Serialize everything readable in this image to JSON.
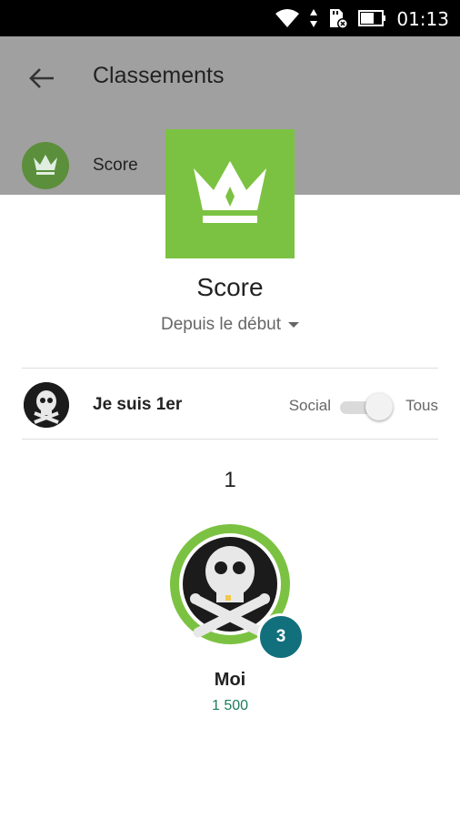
{
  "status_bar": {
    "time": "01:13",
    "icons": [
      "wifi-icon",
      "data-arrows-icon",
      "sd-card-icon",
      "battery-icon"
    ]
  },
  "app_bar": {
    "title": "Classements",
    "back_icon": "arrow-left-icon"
  },
  "leaderboard_item": {
    "label": "Score",
    "icon": "crown-icon",
    "color": "#5c8f3b"
  },
  "leaderboard": {
    "tile_color": "#7cc242",
    "title": "Score",
    "period": "Depuis le début",
    "player_title": "Je suis 1er",
    "toggle_left": "Social",
    "toggle_right": "Tous",
    "rank": "1",
    "player_name": "Moi",
    "score": "1 500",
    "level": "3",
    "level_color": "#126f7c"
  }
}
